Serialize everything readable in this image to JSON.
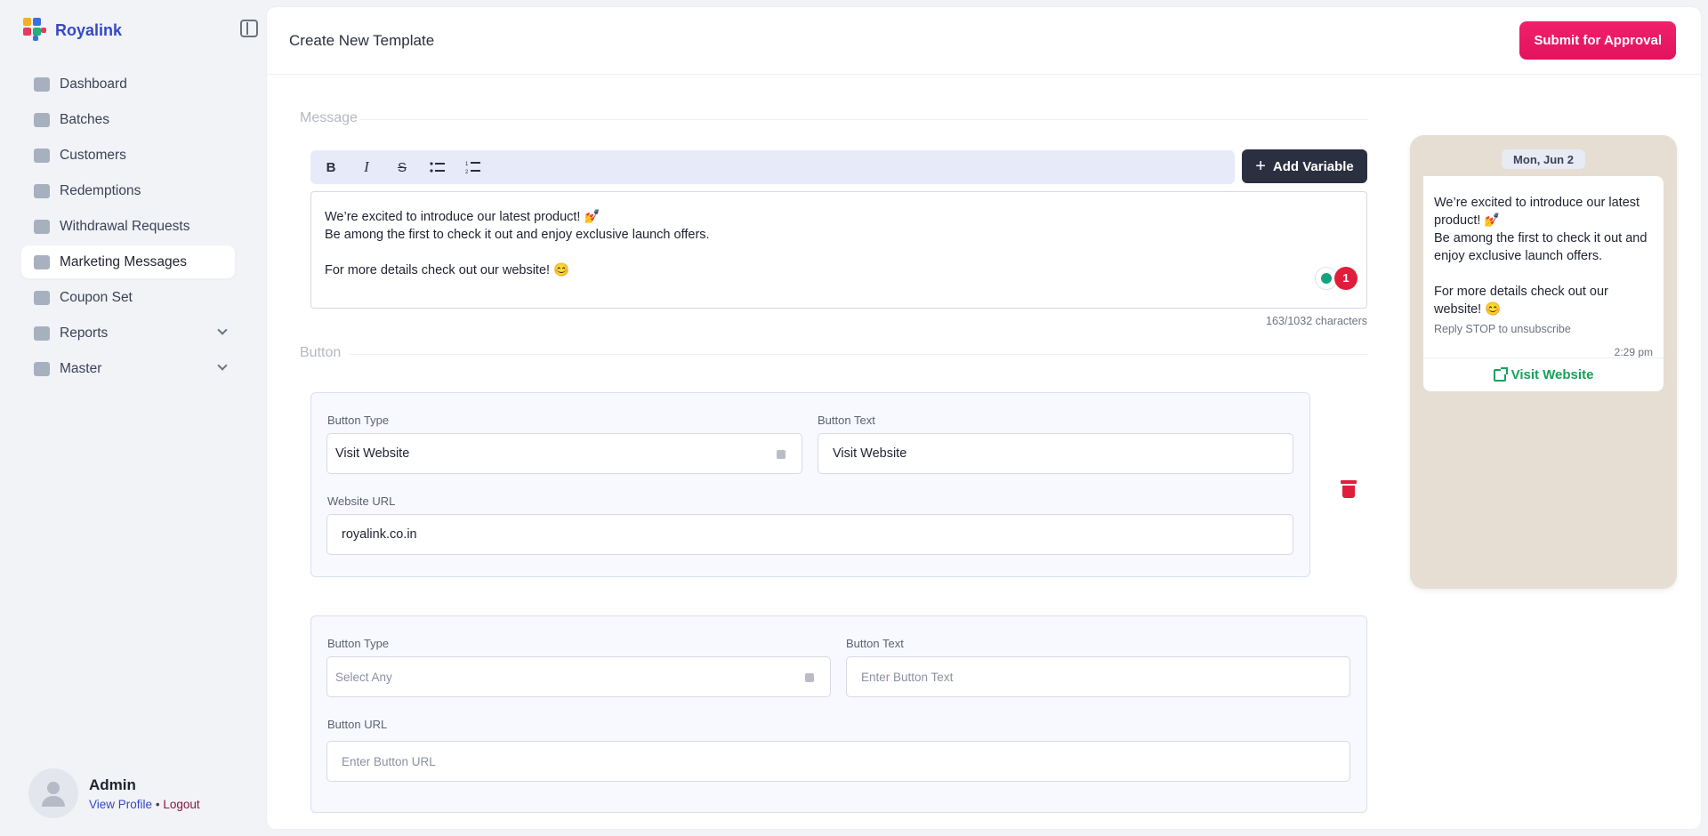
{
  "app": {
    "name": "Royalink"
  },
  "sidebar": {
    "items": [
      {
        "label": "Dashboard",
        "icon": "home-icon"
      },
      {
        "label": "Batches",
        "icon": "batches-icon"
      },
      {
        "label": "Customers",
        "icon": "customers-icon"
      },
      {
        "label": "Redemptions",
        "icon": "redemptions-icon"
      },
      {
        "label": "Withdrawal Requests",
        "icon": "withdrawal-icon"
      },
      {
        "label": "Marketing Messages",
        "icon": "chat-icon",
        "active": true
      },
      {
        "label": "Coupon Set",
        "icon": "coupon-icon"
      },
      {
        "label": "Reports",
        "icon": "reports-icon",
        "expandable": true
      },
      {
        "label": "Master",
        "icon": "master-icon",
        "expandable": true
      }
    ]
  },
  "profile": {
    "name": "Admin",
    "view_profile": "View Profile",
    "separator": "•",
    "logout": "Logout"
  },
  "header": {
    "title": "Create New Template",
    "submit_label": "Submit for Approval"
  },
  "message": {
    "section_label": "Message",
    "add_variable_label": "Add Variable",
    "lines": [
      "We’re excited to introduce our latest product! 💅",
      "Be among the first to check it out and enjoy exclusive launch offers.",
      "",
      "For more details check out our website! 😊"
    ],
    "grammar_issue_count": "1",
    "char_count": "163/1032 characters"
  },
  "buttons": {
    "section_label": "Button",
    "button1": {
      "type_label": "Button Type",
      "type_value": "Visit Website",
      "text_label": "Button Text",
      "text_value": "Visit Website",
      "url_label": "Website URL",
      "url_value": "royalink.co.in"
    },
    "button2": {
      "type_label": "Button Type",
      "type_placeholder": "Select Any",
      "text_label": "Button Text",
      "text_placeholder": "Enter Button Text",
      "url_label": "Button URL",
      "url_placeholder": "Enter Button URL"
    }
  },
  "preview": {
    "date": "Mon, Jun 2",
    "lines": [
      "We’re excited to introduce our latest product! 💅",
      "Be among the first to check it out and enjoy exclusive launch offers.",
      "",
      "For more details check out our website! 😊"
    ],
    "footer": "Reply STOP to unsubscribe",
    "time": "2:29 pm",
    "button_label": "Visit Website"
  },
  "colors": {
    "accent": "#e2125c",
    "brand": "#3548c8",
    "whatsapp_green": "#12a35a"
  }
}
